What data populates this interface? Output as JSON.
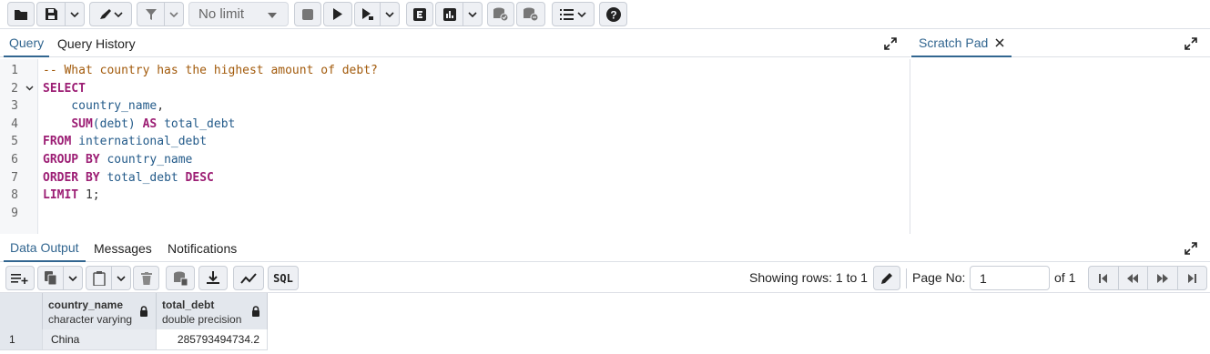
{
  "toolbar": {
    "rows_limit": "No limit"
  },
  "editor_tabs": {
    "query": "Query",
    "history": "Query History"
  },
  "scratch": {
    "title": "Scratch Pad"
  },
  "editor": {
    "line_numbers": [
      "1",
      "2",
      "3",
      "4",
      "5",
      "6",
      "7",
      "8",
      "9"
    ],
    "lines": [
      [
        {
          "t": "-- What country has the highest amount of debt?",
          "c": "cm"
        }
      ],
      [
        {
          "t": "SELECT",
          "c": "kw"
        }
      ],
      [
        {
          "t": "    country_name",
          "c": "id"
        },
        {
          "t": ",",
          "c": "pn"
        }
      ],
      [
        {
          "t": "    ",
          "c": "pn"
        },
        {
          "t": "SUM",
          "c": "fn"
        },
        {
          "t": "(debt) ",
          "c": "id"
        },
        {
          "t": "AS",
          "c": "kw"
        },
        {
          "t": " total_debt",
          "c": "id"
        }
      ],
      [
        {
          "t": "FROM",
          "c": "kw"
        },
        {
          "t": " international_debt",
          "c": "id"
        }
      ],
      [
        {
          "t": "GROUP BY",
          "c": "kw"
        },
        {
          "t": " country_name",
          "c": "id"
        }
      ],
      [
        {
          "t": "ORDER BY",
          "c": "kw"
        },
        {
          "t": " total_debt ",
          "c": "id"
        },
        {
          "t": "DESC",
          "c": "kw"
        }
      ],
      [
        {
          "t": "LIMIT",
          "c": "kw"
        },
        {
          "t": " 1",
          "c": "pn"
        },
        {
          "t": ";",
          "c": "pn"
        }
      ],
      []
    ]
  },
  "output_tabs": {
    "data": "Data Output",
    "messages": "Messages",
    "notifications": "Notifications"
  },
  "results": {
    "showing_rows": "Showing rows: 1 to 1",
    "page_label": "Page No:",
    "page_value": "1",
    "of_pages": "of 1",
    "sql_label": "SQL",
    "columns": [
      {
        "name": "country_name",
        "type": "character varying"
      },
      {
        "name": "total_debt",
        "type": "double precision"
      }
    ],
    "rows": [
      {
        "num": "1",
        "cells": [
          "China",
          "285793494734.2"
        ]
      }
    ]
  },
  "icons": {
    "toolbar": [
      "folder-icon",
      "save-icon",
      "chevron-down-icon",
      "pen-icon",
      "filter-icon",
      "stop-icon",
      "play-icon",
      "explain-icon",
      "explain-e-icon",
      "chart-icon",
      "commit-icon",
      "rollback-icon",
      "list-icon",
      "help-icon"
    ]
  }
}
